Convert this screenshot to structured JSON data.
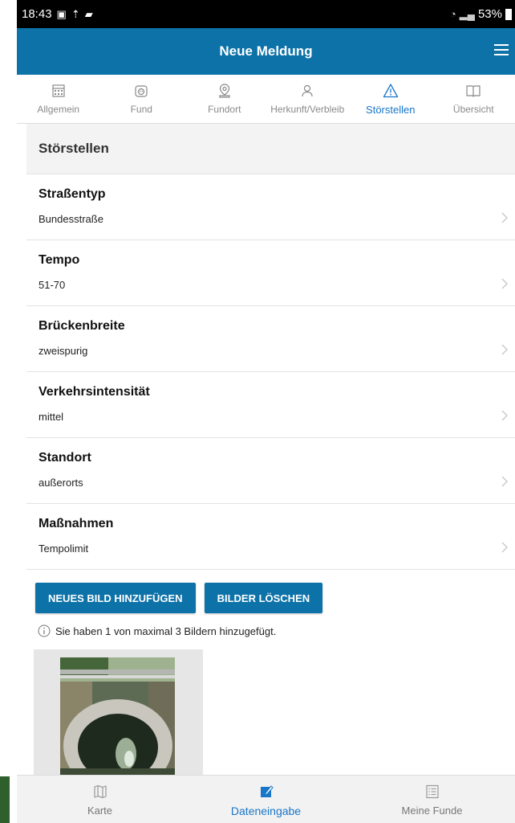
{
  "status": {
    "time": "18:43",
    "battery": "53%"
  },
  "appbar": {
    "title": "Neue Meldung"
  },
  "tabs": [
    {
      "label": "Allgemein",
      "icon": "calendar-icon",
      "active": false
    },
    {
      "label": "Fund",
      "icon": "animal-icon",
      "active": false
    },
    {
      "label": "Fundort",
      "icon": "location-pin-icon",
      "active": false
    },
    {
      "label": "Herkunft/Verbleib",
      "icon": "person-icon",
      "active": false
    },
    {
      "label": "Störstellen",
      "icon": "warning-icon",
      "active": true
    },
    {
      "label": "Übersicht",
      "icon": "book-icon",
      "active": false
    }
  ],
  "section": {
    "title": "Störstellen"
  },
  "fields": [
    {
      "label": "Straßentyp",
      "value": "Bundesstraße"
    },
    {
      "label": "Tempo",
      "value": "51-70"
    },
    {
      "label": "Brückenbreite",
      "value": "zweispurig"
    },
    {
      "label": "Verkehrsintensität",
      "value": "mittel"
    },
    {
      "label": "Standort",
      "value": "außerorts"
    },
    {
      "label": "Maßnahmen",
      "value": "Tempolimit"
    }
  ],
  "buttons": {
    "add_image": "NEUES BILD HINZUFÜGEN",
    "delete_images": "BILDER LÖSCHEN"
  },
  "info_text": "Sie haben 1 von maximal 3 Bildern hinzugefügt.",
  "bottom_nav": [
    {
      "label": "Karte",
      "icon": "map-icon",
      "active": false
    },
    {
      "label": "Dateneingabe",
      "icon": "edit-icon",
      "active": true
    },
    {
      "label": "Meine Funde",
      "icon": "list-icon",
      "active": false
    }
  ],
  "colors": {
    "primary": "#0c72a8",
    "active_tab": "#1976c8"
  }
}
